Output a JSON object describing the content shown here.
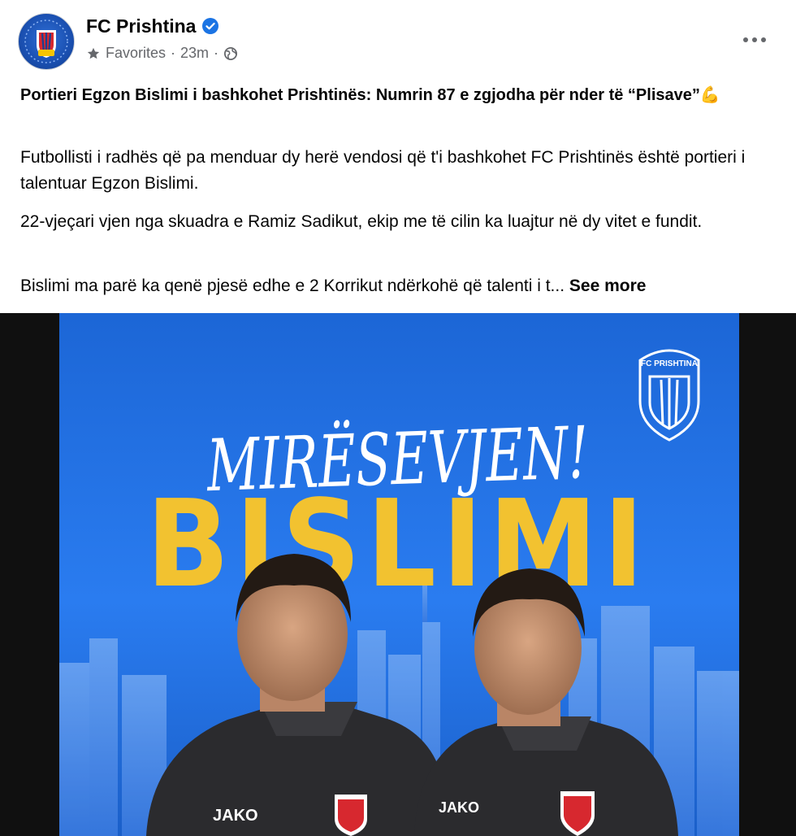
{
  "post": {
    "page_name": "FC Prishtina",
    "audience_label": "Favorites",
    "separator": "·",
    "time": "23m",
    "headline": "Portieri Egzon Bislimi i bashkohet Prishtinës: Numrin 87 e zgjodha për nder të “Plisave”💪",
    "paragraphs": [
      "Futbollisti i radhës që pa menduar dy herë vendosi që t'i bashkohet FC Prishtinës është portieri i talentuar Egzon Bislimi.",
      "22-vjeçari vjen nga skuadra e Ramiz Sadikut, ekip me të cilin ka luajtur në dy vitet e fundit.",
      "Bislimi ma parë ka qenë pjesë edhe e 2 Korrikut ndërkohë që talenti i t..."
    ],
    "see_more": "See more"
  },
  "image": {
    "banner_script": "MIRËSEVJEN!",
    "banner_name": "BISLIMI",
    "badge_text": "FC PRISHTINA",
    "shirt_brand": "JAKO",
    "colors": {
      "sky": "#1e6fe0",
      "yellow": "#f2c230",
      "shirt": "#2b2b2e",
      "badge_red": "#d7282f"
    }
  },
  "icons": {
    "verified": "verified-badge-icon",
    "favorites": "star-icon",
    "privacy": "globe-icon",
    "more": "more-options-icon"
  }
}
